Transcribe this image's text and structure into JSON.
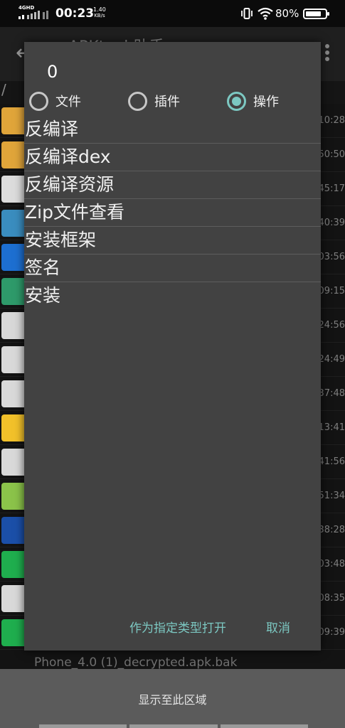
{
  "status_bar": {
    "network": "4GHD",
    "time": "00:23",
    "speed_value": "1.40",
    "speed_unit": "KB/s",
    "battery": "80%",
    "battery_level": 0.8
  },
  "app": {
    "title": "APKtool 助手",
    "path": "/",
    "last_file_name": "Phone_4.0 (1)_decrypted.apk.bak",
    "file_times": [
      "10:28",
      "50:50",
      "45:17",
      "40:39",
      "03:56",
      "09:15",
      "24:56",
      "24:49",
      "37:48",
      "13:41",
      "41:56",
      "51:34",
      "38:28",
      "03:48",
      "08:35",
      "09:39"
    ],
    "file_icons": [
      {
        "name": "folder-icon",
        "color": "#e0a53a"
      },
      {
        "name": "folder-icon",
        "color": "#e0a53a"
      },
      {
        "name": "ink-app-icon",
        "color": "#dcdcdc"
      },
      {
        "name": "android-app-icon",
        "color": "#3a8dbf"
      },
      {
        "name": "q-app-icon",
        "color": "#1d6fd1"
      },
      {
        "name": "green-app-icon",
        "color": "#2e9a6a"
      },
      {
        "name": "red-badge-icon",
        "color": "#d8d8d8"
      },
      {
        "name": "blank-file-icon",
        "color": "#d9d9d9"
      },
      {
        "name": "blank-file-icon",
        "color": "#d9d9d9"
      },
      {
        "name": "lemon-app-icon",
        "color": "#f2c12a"
      },
      {
        "name": "blank-file-icon",
        "color": "#d9d9d9"
      },
      {
        "name": "android-robot-icon",
        "color": "#8bc34a"
      },
      {
        "name": "blue-waves-icon",
        "color": "#1b4fa8"
      },
      {
        "name": "green-phone-icon",
        "color": "#1fae4e"
      },
      {
        "name": "blank-file-icon",
        "color": "#d9d9d9"
      },
      {
        "name": "green-phone-icon",
        "color": "#1fae4e"
      }
    ]
  },
  "bottom_bar": {
    "label": "显示至此区域"
  },
  "dialog": {
    "title": "0",
    "radios": [
      {
        "label": "文件",
        "checked": false
      },
      {
        "label": "插件",
        "checked": false
      },
      {
        "label": "操作",
        "checked": true
      }
    ],
    "options": [
      "反编译",
      "反编译dex",
      "反编译资源",
      "Zip文件查看",
      "安装框架",
      "签名",
      "安装"
    ],
    "actions": {
      "open_as": "作为指定类型打开",
      "cancel": "取消"
    }
  },
  "colors": {
    "accent": "#7cc8c2",
    "dialog_bg": "#424242"
  }
}
